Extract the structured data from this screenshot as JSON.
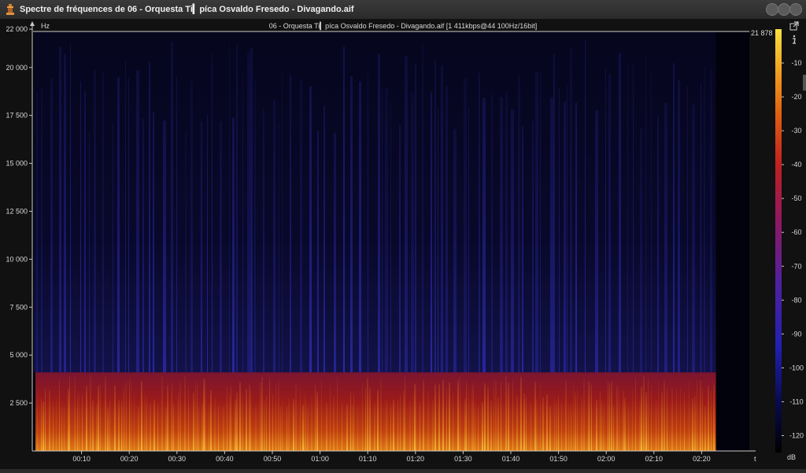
{
  "window": {
    "title": "Spectre de fréquences de 06 - Orquesta Ti▎píca Osvaldo Fresedo - Divagando.aif",
    "icon": "app-icon",
    "buttons": [
      "minimize-icon",
      "maximize-icon",
      "close-icon"
    ]
  },
  "plot": {
    "header": "06 - Orquesta Ti▎píca Osvaldo Fresedo - Divagando.aif [1 411kbps@44 100Hz/16bit]",
    "y_unit": "Hz",
    "max_freq_label": "21 878",
    "x_end_label": "t",
    "colorbar_unit": "dB",
    "colors": {
      "background": "#111111",
      "spectro_dark": "#02020e",
      "spectro_blue": "#1a1a78",
      "spectro_red": "#8c1a1a",
      "spectro_orange": "#e06a10",
      "spectro_yellow": "#f2d230"
    }
  },
  "chart_data": {
    "type": "heatmap",
    "title": "",
    "xlabel": "",
    "ylabel": "Hz",
    "y_ticks": [
      "22 000",
      "20 000",
      "17 500",
      "15 000",
      "12 500",
      "10 000",
      "7 500",
      "5 000",
      "2 500"
    ],
    "y_tick_values": [
      22000,
      20000,
      17500,
      15000,
      12500,
      10000,
      7500,
      5000,
      2500
    ],
    "x_ticks": [
      "00:10",
      "00:20",
      "00:30",
      "00:40",
      "00:50",
      "01:00",
      "01:10",
      "01:20",
      "01:30",
      "01:40",
      "01:50",
      "02:00",
      "02:10",
      "02:20"
    ],
    "x_tick_seconds": [
      10,
      20,
      30,
      40,
      50,
      60,
      70,
      80,
      90,
      100,
      110,
      120,
      130,
      140
    ],
    "ylim": [
      0,
      22000
    ],
    "xlim_seconds": [
      0,
      150
    ],
    "cutoff_frequency_hz": 4100,
    "duration_seconds": 143,
    "colorbar": {
      "unit": "dB",
      "ticks": [
        "-10",
        "-20",
        "-30",
        "-40",
        "-50",
        "-60",
        "-70",
        "-80",
        "-90",
        "-100",
        "-110",
        "-120"
      ],
      "tick_values": [
        -10,
        -20,
        -30,
        -40,
        -50,
        -60,
        -70,
        -80,
        -90,
        -100,
        -110,
        -120
      ],
      "range": [
        -125,
        0
      ]
    }
  }
}
